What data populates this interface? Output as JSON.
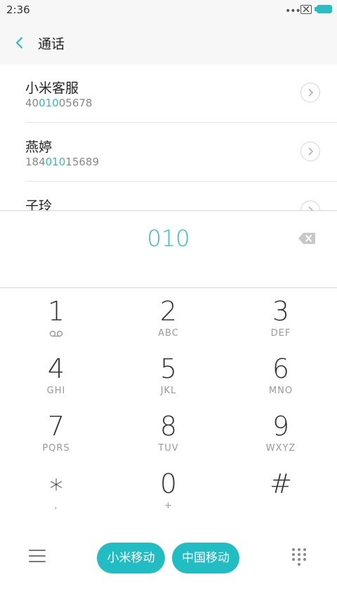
{
  "status_bar": {
    "time": "2:36",
    "dots": "•••"
  },
  "header": {
    "title": "通话"
  },
  "contacts": [
    {
      "name": "小米客服",
      "number_pre": "40",
      "number_match": "010",
      "number_post": "05678"
    },
    {
      "name": "燕婷",
      "number_pre": "184",
      "number_match": "010",
      "number_post": "15689"
    },
    {
      "name": "子玲",
      "number_pre": "",
      "number_match": "",
      "number_post": ""
    }
  ],
  "dial": {
    "input": "010"
  },
  "keypad": [
    {
      "digit": "1",
      "letters": ""
    },
    {
      "digit": "2",
      "letters": "ABC"
    },
    {
      "digit": "3",
      "letters": "DEF"
    },
    {
      "digit": "4",
      "letters": "GHI"
    },
    {
      "digit": "5",
      "letters": "JKL"
    },
    {
      "digit": "6",
      "letters": "MNO"
    },
    {
      "digit": "7",
      "letters": "PQRS"
    },
    {
      "digit": "8",
      "letters": "TUV"
    },
    {
      "digit": "9",
      "letters": "WXYZ"
    },
    {
      "digit": "∗",
      "letters": ","
    },
    {
      "digit": "0",
      "letters": "+"
    },
    {
      "digit": "#",
      "letters": ""
    }
  ],
  "bottom": {
    "call_sim1": "小米移动",
    "call_sim2": "中国移动"
  },
  "colors": {
    "accent": "#2bbdc1",
    "call_button": "#22bcc3"
  }
}
